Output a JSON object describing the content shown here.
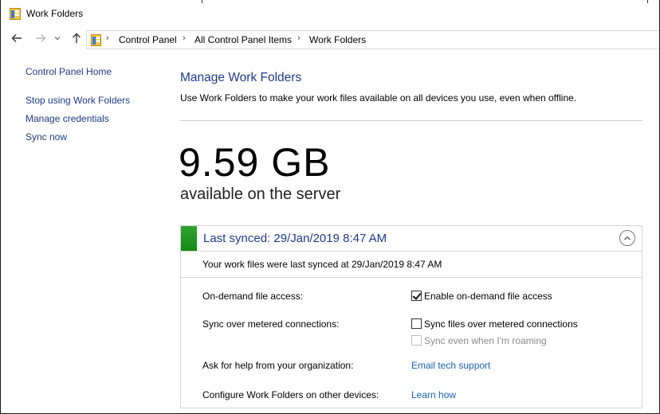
{
  "window": {
    "title": "Work Folders"
  },
  "nav": {
    "back_icon": "arrow-left-icon",
    "forward_icon": "arrow-right-icon",
    "recent_icon": "chevron-down-icon",
    "up_icon": "arrow-up-icon"
  },
  "breadcrumb": [
    "Control Panel",
    "All Control Panel Items",
    "Work Folders"
  ],
  "sidebar": {
    "items": [
      {
        "label": "Control Panel Home"
      },
      {
        "label": "Stop using Work Folders"
      },
      {
        "label": "Manage credentials"
      },
      {
        "label": "Sync now"
      }
    ]
  },
  "main": {
    "heading": "Manage Work Folders",
    "description": "Use Work Folders to make your work files available on all devices you use, even when offline.",
    "available_size": "9.59 GB",
    "available_caption": "available on the server"
  },
  "panel": {
    "title": "Last synced: 29/Jan/2019 8:47 AM",
    "status_color": "#1f9a1f",
    "synced_detail": "Your work files were last synced at 29/Jan/2019 8:47 AM",
    "rows": {
      "on_demand": {
        "label": "On-demand file access:",
        "option": "Enable on-demand file access",
        "checked": true
      },
      "metered": {
        "label": "Sync over metered connections:",
        "option": "Sync files over metered connections",
        "checked": false,
        "sub_option": "Sync even when I'm roaming",
        "sub_checked": false,
        "sub_disabled": true
      },
      "help": {
        "label": "Ask for help from your organization:",
        "link": "Email tech support"
      },
      "configure": {
        "label": "Configure Work Folders on other devices:",
        "link": "Learn how"
      }
    }
  }
}
